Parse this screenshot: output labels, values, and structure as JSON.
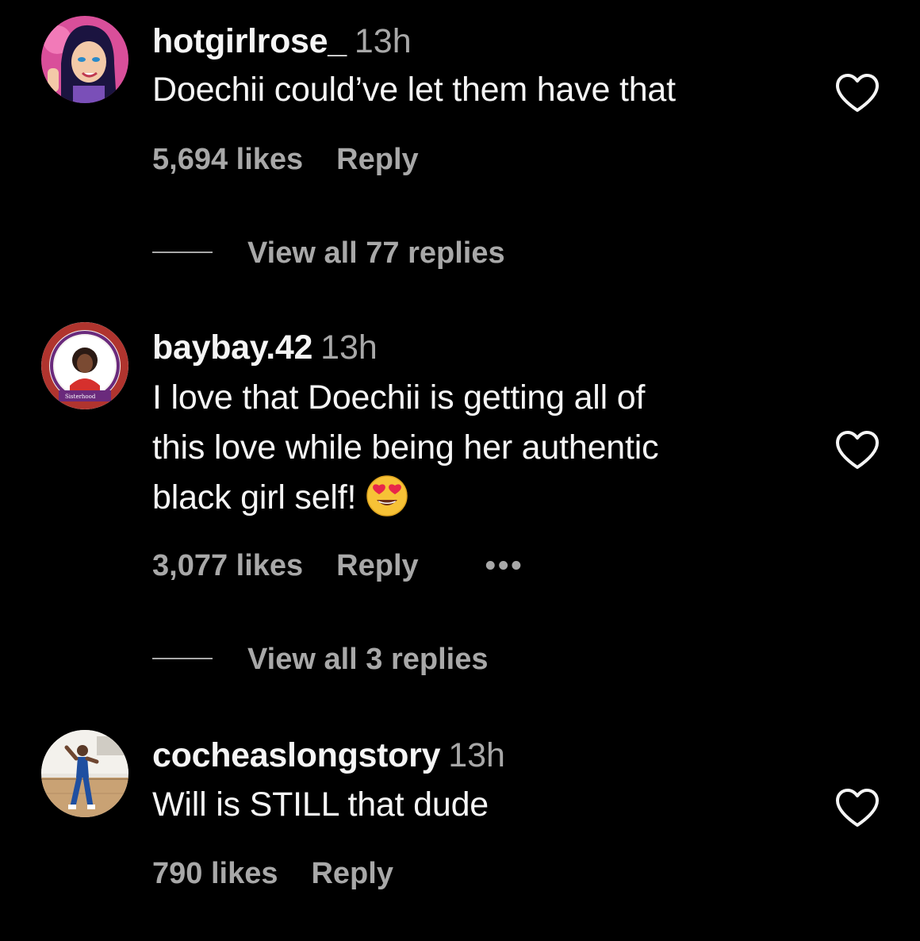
{
  "comments": [
    {
      "username": "hotgirlrose_",
      "time": "13h",
      "text_lines": [
        "Doechii could’ve let them have that"
      ],
      "likes": "5,694 likes",
      "reply_label": "Reply",
      "view_replies": "View all 77 replies",
      "avatar": "cartoon-woman-avatar",
      "liked": false
    },
    {
      "username": "baybay.42",
      "time": "13h",
      "text_lines": [
        "I love that Doechii is getting all of",
        "this love while being her authentic",
        "black girl self!"
      ],
      "emoji": "heart-eyes-emoji",
      "likes": "3,077 likes",
      "reply_label": "Reply",
      "more": "•••",
      "view_replies": "View all 3 replies",
      "avatar": "sorority-badge-avatar",
      "liked": false
    },
    {
      "username": "cocheaslongstory",
      "time": "13h",
      "text_lines": [
        "Will is STILL that dude"
      ],
      "likes": "790 likes",
      "reply_label": "Reply",
      "avatar": "gym-woman-avatar",
      "liked": false
    }
  ],
  "colors": {
    "background": "#000000",
    "primary_text": "#f5f5f5",
    "secondary_text": "#a8a8a8"
  }
}
